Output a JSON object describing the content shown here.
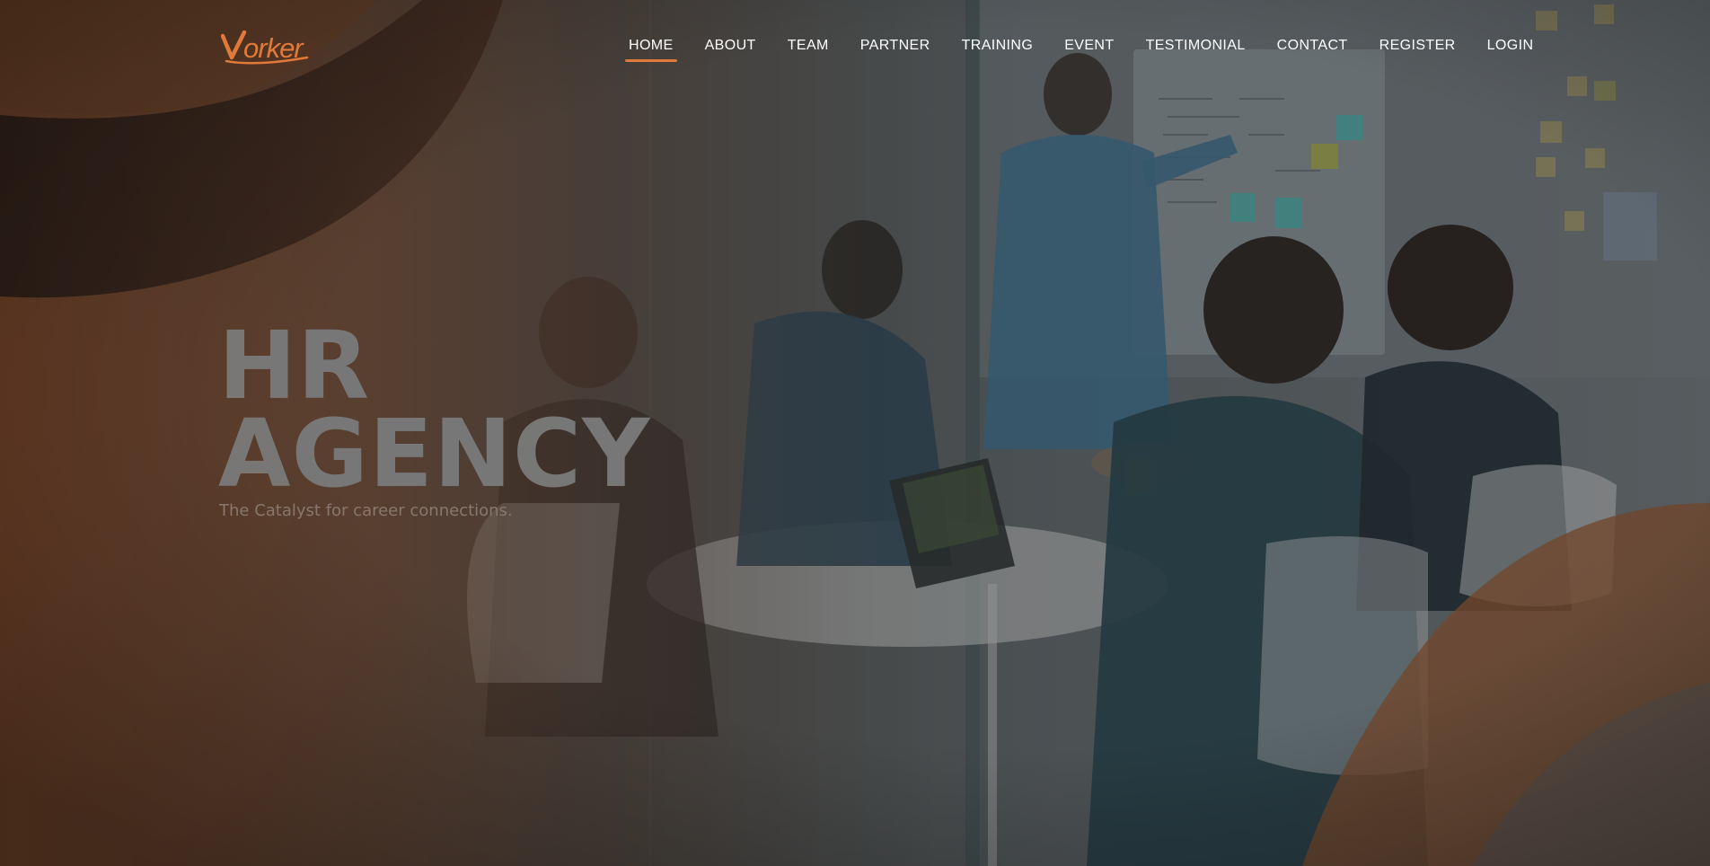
{
  "brand": {
    "logo_text": "vorker",
    "accent_color": "#e07a3a"
  },
  "nav": {
    "items": [
      {
        "label": "HOME",
        "active": true
      },
      {
        "label": "ABOUT",
        "active": false
      },
      {
        "label": "TEAM",
        "active": false
      },
      {
        "label": "PARTNER",
        "active": false
      },
      {
        "label": "TRAINING",
        "active": false
      },
      {
        "label": "EVENT",
        "active": false
      },
      {
        "label": "TESTIMONIAL",
        "active": false
      },
      {
        "label": "CONTACT",
        "active": false
      },
      {
        "label": "REGISTER",
        "active": false
      },
      {
        "label": "LOGIN",
        "active": false
      }
    ]
  },
  "hero": {
    "title_line1": "HR",
    "title_line2": "AGENCY",
    "subtitle": "The Catalyst for career connections."
  },
  "colors": {
    "overlay_orange": "#b8652d",
    "overlay_dark": "#1a1a1c",
    "title": "#7a7b7b",
    "subtitle": "#8a7b70"
  }
}
